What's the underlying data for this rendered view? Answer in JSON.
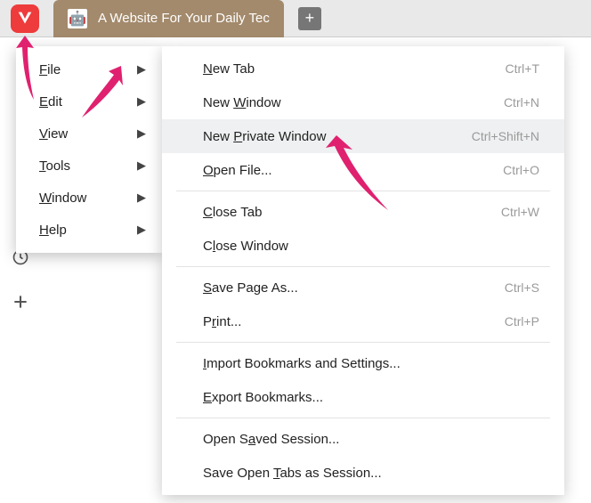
{
  "tabbar": {
    "tab_title": "A Website For Your Daily Tec",
    "favicon_emoji": "🤖",
    "newtab_glyph": "+"
  },
  "menubar": {
    "items": [
      {
        "label_pre": "",
        "label_u": "F",
        "label_post": "ile"
      },
      {
        "label_pre": "",
        "label_u": "E",
        "label_post": "dit"
      },
      {
        "label_pre": "",
        "label_u": "V",
        "label_post": "iew"
      },
      {
        "label_pre": "",
        "label_u": "T",
        "label_post": "ools"
      },
      {
        "label_pre": "",
        "label_u": "W",
        "label_post": "indow"
      },
      {
        "label_pre": "",
        "label_u": "H",
        "label_post": "elp"
      }
    ]
  },
  "submenu": {
    "group1": [
      {
        "pre": "",
        "u": "N",
        "post": "ew Tab",
        "shortcut": "Ctrl+T"
      },
      {
        "pre": "New ",
        "u": "W",
        "post": "indow",
        "shortcut": "Ctrl+N"
      },
      {
        "pre": "New ",
        "u": "P",
        "post": "rivate Window",
        "shortcut": "Ctrl+Shift+N",
        "hover": true
      },
      {
        "pre": "",
        "u": "O",
        "post": "pen File...",
        "shortcut": "Ctrl+O"
      }
    ],
    "group2": [
      {
        "pre": "",
        "u": "C",
        "post": "lose Tab",
        "shortcut": "Ctrl+W"
      },
      {
        "pre": "C",
        "u": "l",
        "post": "ose Window",
        "shortcut": ""
      }
    ],
    "group3": [
      {
        "pre": "",
        "u": "S",
        "post": "ave Page As...",
        "shortcut": "Ctrl+S"
      },
      {
        "pre": "P",
        "u": "r",
        "post": "int...",
        "shortcut": "Ctrl+P"
      }
    ],
    "group4": [
      {
        "pre": "",
        "u": "I",
        "post": "mport Bookmarks and Settings...",
        "shortcut": ""
      },
      {
        "pre": "",
        "u": "E",
        "post": "xport Bookmarks...",
        "shortcut": ""
      }
    ],
    "group5": [
      {
        "pre": "Open S",
        "u": "a",
        "post": "ved Session...",
        "shortcut": ""
      },
      {
        "pre": "Save Open ",
        "u": "T",
        "post": "abs as Session...",
        "shortcut": ""
      }
    ]
  },
  "arrows": {
    "color": "#e0216f"
  }
}
